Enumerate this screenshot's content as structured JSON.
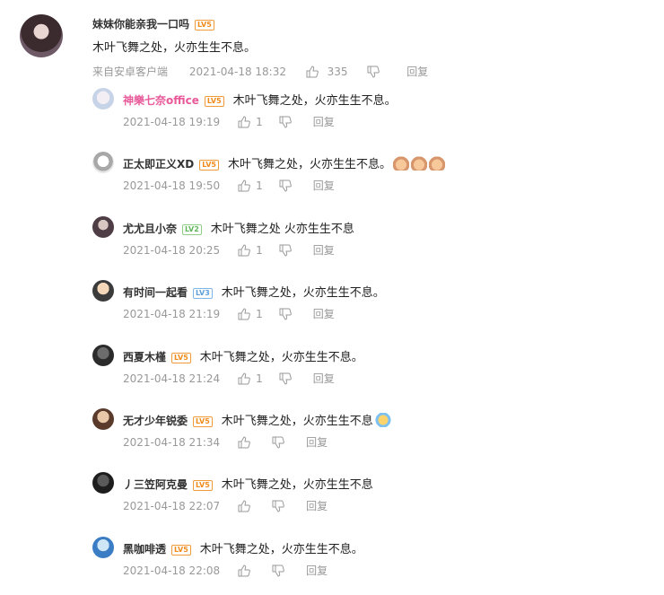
{
  "main_comment": {
    "username": "妹妹你能亲我一口吗",
    "level": "LV5",
    "text": "木叶飞舞之处，火亦生生不息。",
    "source": "来自安卓客户端",
    "time": "2021-04-18 18:32",
    "likes": "335",
    "reply_label": "回复",
    "avatar_icon": "anime-girl-avatar"
  },
  "replies": [
    {
      "username": "神樂七奈office",
      "level": "LV5",
      "text": "木叶飞舞之处，火亦生生不息。",
      "emojis": [],
      "time": "2021-04-18 19:19",
      "likes": "1",
      "reply_label": "回复",
      "name_color": "#e85a9a",
      "avatar_icon": "anime-avatar-light"
    },
    {
      "username": "正太即正义XD",
      "level": "LV5",
      "text": "木叶飞舞之处，火亦生生不息。",
      "emojis": [
        "dog-emoji",
        "dog-emoji",
        "dog-emoji"
      ],
      "time": "2021-04-18 19:50",
      "likes": "1",
      "reply_label": "回复",
      "name_color": "#333333",
      "avatar_icon": "sketch-avatar"
    },
    {
      "username": "尤尤且小奈",
      "level": "LV2",
      "text": "木叶飞舞之处 火亦生生不息",
      "emojis": [],
      "time": "2021-04-18 20:25",
      "likes": "1",
      "reply_label": "回复",
      "name_color": "#333333",
      "avatar_icon": "anime-avatar-dark"
    },
    {
      "username": "有时间一起看",
      "level": "LV3",
      "text": "木叶飞舞之处，火亦生生不息。",
      "emojis": [],
      "time": "2021-04-18 21:19",
      "likes": "1",
      "reply_label": "回复",
      "name_color": "#333333",
      "avatar_icon": "cartoon-avatar"
    },
    {
      "username": "西夏木槿",
      "level": "LV5",
      "text": "木叶飞舞之处，火亦生生不息。",
      "emojis": [],
      "time": "2021-04-18 21:24",
      "likes": "1",
      "reply_label": "回复",
      "name_color": "#333333",
      "avatar_icon": "dark-avatar"
    },
    {
      "username": "无才少年锐委",
      "level": "LV5",
      "text": "木叶飞舞之处，火亦生生不息",
      "emojis": [
        "face-cover-emoji"
      ],
      "time": "2021-04-18 21:34",
      "likes": "",
      "reply_label": "回复",
      "name_color": "#333333",
      "avatar_icon": "anime-avatar-brown"
    },
    {
      "username": "丿三笠阿克曼",
      "level": "LV5",
      "text": "木叶飞舞之处，火亦生生不息",
      "emojis": [],
      "time": "2021-04-18 22:07",
      "likes": "",
      "reply_label": "回复",
      "name_color": "#333333",
      "avatar_icon": "dark-avatar-2"
    },
    {
      "username": "黑咖啡透",
      "level": "LV5",
      "text": "木叶飞舞之处，火亦生生不息。",
      "emojis": [],
      "time": "2021-04-18 22:08",
      "likes": "",
      "reply_label": "回复",
      "name_color": "#333333",
      "avatar_icon": "sky-avatar"
    }
  ],
  "colors": {
    "level_orange": "#f08a1a",
    "meta_gray": "#999999"
  }
}
